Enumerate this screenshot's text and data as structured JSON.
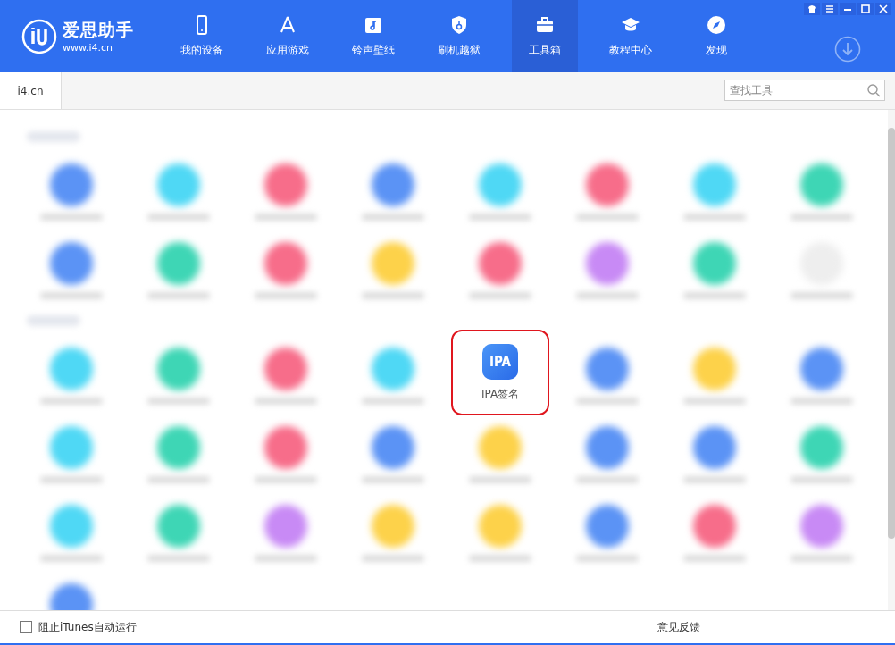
{
  "app": {
    "name": "爱思助手",
    "url": "www.i4.cn"
  },
  "nav": [
    {
      "label": "我的设备",
      "kind": "phone",
      "selected": false
    },
    {
      "label": "应用游戏",
      "kind": "appstore",
      "selected": false
    },
    {
      "label": "铃声壁纸",
      "kind": "music",
      "selected": false
    },
    {
      "label": "刷机越狱",
      "kind": "shield",
      "selected": false
    },
    {
      "label": "工具箱",
      "kind": "toolbox",
      "selected": true
    },
    {
      "label": "教程中心",
      "kind": "cap",
      "selected": false
    },
    {
      "label": "发现",
      "kind": "compass",
      "selected": false
    }
  ],
  "tabs": [
    {
      "label": "i4.cn",
      "selected": true
    }
  ],
  "search": {
    "placeholder": "查找工具"
  },
  "sections": [
    {
      "tiles": [
        {
          "kind": "blurred",
          "color": "#5b93f5"
        },
        {
          "kind": "blurred",
          "color": "#4fd8f5"
        },
        {
          "kind": "blurred",
          "color": "#f76d8a"
        },
        {
          "kind": "blurred",
          "color": "#5b93f5"
        },
        {
          "kind": "blurred",
          "color": "#4fd8f5"
        },
        {
          "kind": "blurred",
          "color": "#f76d8a"
        },
        {
          "kind": "blurred",
          "color": "#4fd8f5"
        },
        {
          "kind": "blurred",
          "color": "#3ed6b5"
        },
        {
          "kind": "blurred",
          "color": "#5b93f5"
        },
        {
          "kind": "blurred",
          "color": "#3ed6b5"
        },
        {
          "kind": "blurred",
          "color": "#f76d8a"
        },
        {
          "kind": "blurred",
          "color": "#fdd24a"
        },
        {
          "kind": "blurred",
          "color": "#f76d8a"
        },
        {
          "kind": "blurred",
          "color": "#c88af5"
        },
        {
          "kind": "blurred",
          "color": "#3ed6b5"
        },
        {
          "kind": "blurred",
          "color": "#eeeeee"
        }
      ]
    },
    {
      "tiles": [
        {
          "kind": "blurred",
          "color": "#4fd8f5"
        },
        {
          "kind": "blurred",
          "color": "#3ed6b5"
        },
        {
          "kind": "blurred",
          "color": "#f76d8a"
        },
        {
          "kind": "blurred",
          "color": "#4fd8f5"
        },
        {
          "kind": "tool",
          "label": "IPA签名",
          "icon_text": "IPA",
          "highlighted": true
        },
        {
          "kind": "blurred",
          "color": "#5b93f5"
        },
        {
          "kind": "blurred",
          "color": "#fdd24a"
        },
        {
          "kind": "blurred",
          "color": "#5b93f5"
        },
        {
          "kind": "blurred",
          "color": "#4fd8f5"
        },
        {
          "kind": "blurred",
          "color": "#3ed6b5"
        },
        {
          "kind": "blurred",
          "color": "#f76d8a"
        },
        {
          "kind": "blurred",
          "color": "#5b93f5"
        },
        {
          "kind": "blurred",
          "color": "#fdd24a"
        },
        {
          "kind": "blurred",
          "color": "#5b93f5"
        },
        {
          "kind": "blurred",
          "color": "#5b93f5"
        },
        {
          "kind": "blurred",
          "color": "#3ed6b5"
        },
        {
          "kind": "blurred",
          "color": "#4fd8f5"
        },
        {
          "kind": "blurred",
          "color": "#3ed6b5"
        },
        {
          "kind": "blurred",
          "color": "#c88af5"
        },
        {
          "kind": "blurred",
          "color": "#fdd24a"
        },
        {
          "kind": "blurred",
          "color": "#fdd24a"
        },
        {
          "kind": "blurred",
          "color": "#5b93f5"
        },
        {
          "kind": "blurred",
          "color": "#f76d8a"
        },
        {
          "kind": "blurred",
          "color": "#c88af5"
        },
        {
          "kind": "blurred",
          "color": "#5b93f5"
        }
      ]
    }
  ],
  "footer": {
    "option": {
      "label": "阻止iTunes自动运行",
      "checked": false
    },
    "feedback": "意见反馈"
  }
}
